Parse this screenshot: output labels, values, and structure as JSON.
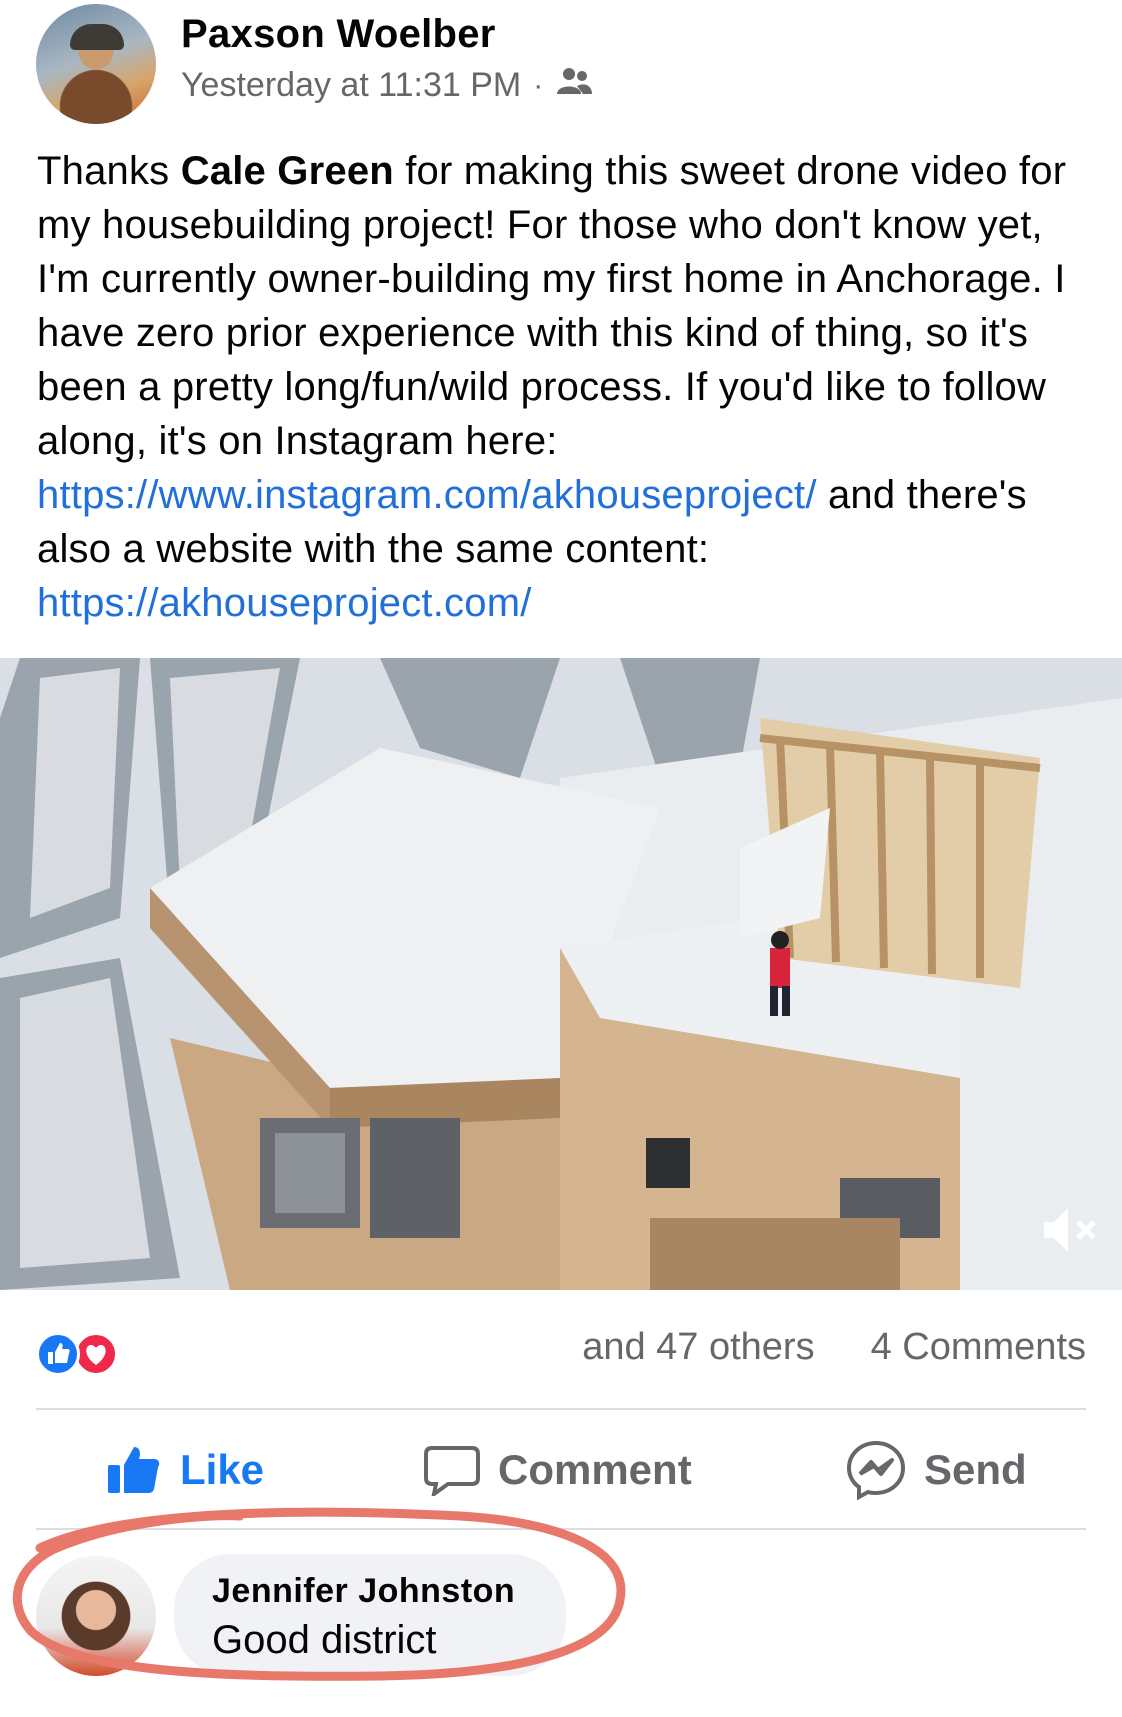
{
  "post": {
    "author": "Paxson Woelber",
    "timestamp": "Yesterday at 11:31 PM",
    "separator": "·",
    "audience_icon": "friends-icon",
    "text": {
      "p1": "Thanks ",
      "tagged_name": "Cale Green",
      "p2": " for making this sweet drone video for my housebuilding project! For those who don't know yet, I'm currently owner-building my first home in Anchorage. I have zero prior experience with this kind of thing, so it's been a pretty long/fun/wild process. If you'd like to follow along, it's on Instagram here: ",
      "link1": "https://www.instagram.com/akhouseproject/",
      "p3": " and there's also a website with the same content: ",
      "link2": "https://akhouseproject.com/"
    }
  },
  "video": {
    "mute_icon": "mute-icon"
  },
  "engagement": {
    "reaction_icons": [
      "like-reaction-icon",
      "love-reaction-icon"
    ],
    "reactions_text": "and 47 others",
    "comments_text": "4 Comments"
  },
  "actions": {
    "like": "Like",
    "comment": "Comment",
    "send": "Send"
  },
  "comment": {
    "name": "Jennifer Johnston",
    "text": "Good district"
  },
  "colors": {
    "link": "#216fdb",
    "like_blue": "#1877f2",
    "love_red": "#f02849",
    "muted_text": "#65676b",
    "highlight": "#e8786a"
  }
}
